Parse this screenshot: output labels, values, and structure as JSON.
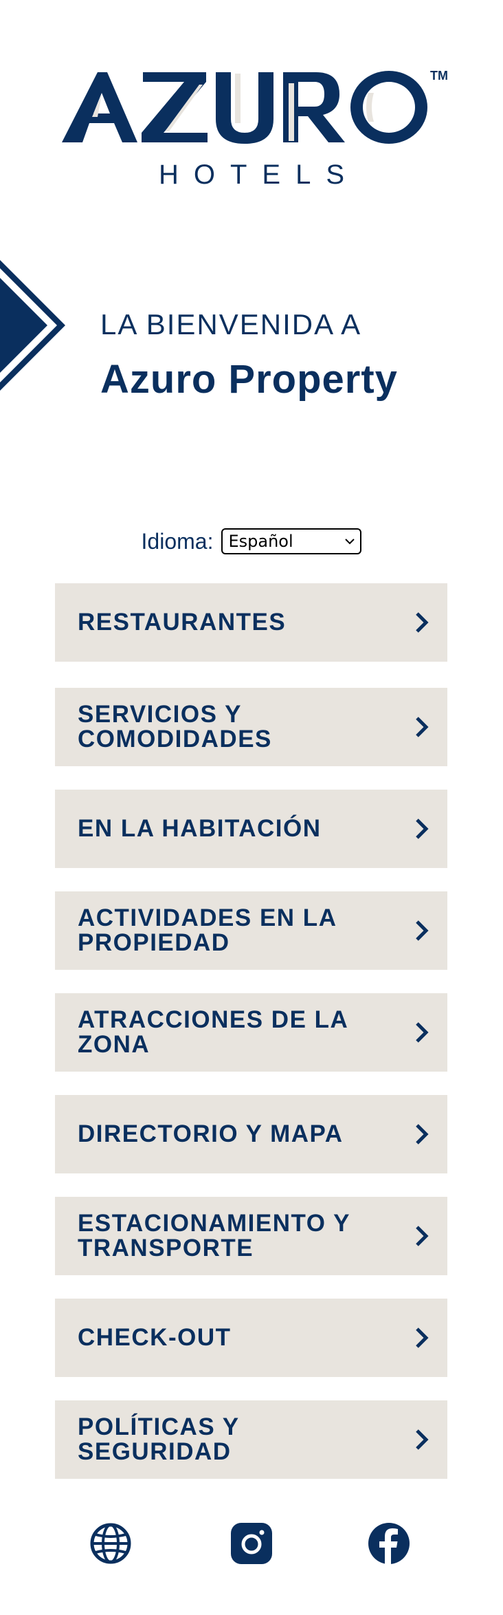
{
  "brand": {
    "logo_word": "AZURO",
    "logo_sub": "HOTELS",
    "trademark": "TM",
    "colors": {
      "navy": "#0a2f5e",
      "tile": "#e8e4de",
      "white": "#ffffff"
    }
  },
  "welcome": {
    "line1": "LA BIENVENIDA A",
    "line2": "Azuro Property"
  },
  "language": {
    "label": "Idioma:",
    "selected": "Español"
  },
  "menu": [
    {
      "label": "RESTAURANTES",
      "icon": "chevron-right-icon"
    },
    {
      "label": "SERVICIOS Y COMODIDADES",
      "icon": "chevron-right-icon"
    },
    {
      "label": "EN LA HABITACIÓN",
      "icon": "chevron-right-icon"
    },
    {
      "label": "ACTIVIDADES EN LA PROPIEDAD",
      "icon": "chevron-right-icon"
    },
    {
      "label": "ATRACCIONES DE LA ZONA",
      "icon": "chevron-right-icon"
    },
    {
      "label": "DIRECTORIO Y MAPA",
      "icon": "chevron-right-icon"
    },
    {
      "label": "ESTACIONAMIENTO Y TRANSPORTE",
      "icon": "chevron-right-icon"
    },
    {
      "label": "CHECK-OUT",
      "icon": "chevron-right-icon"
    },
    {
      "label": "POLÍTICAS Y SEGURIDAD",
      "icon": "chevron-right-icon"
    }
  ],
  "social": [
    {
      "icon": "globe-icon"
    },
    {
      "icon": "instagram-icon"
    },
    {
      "icon": "facebook-icon"
    }
  ]
}
